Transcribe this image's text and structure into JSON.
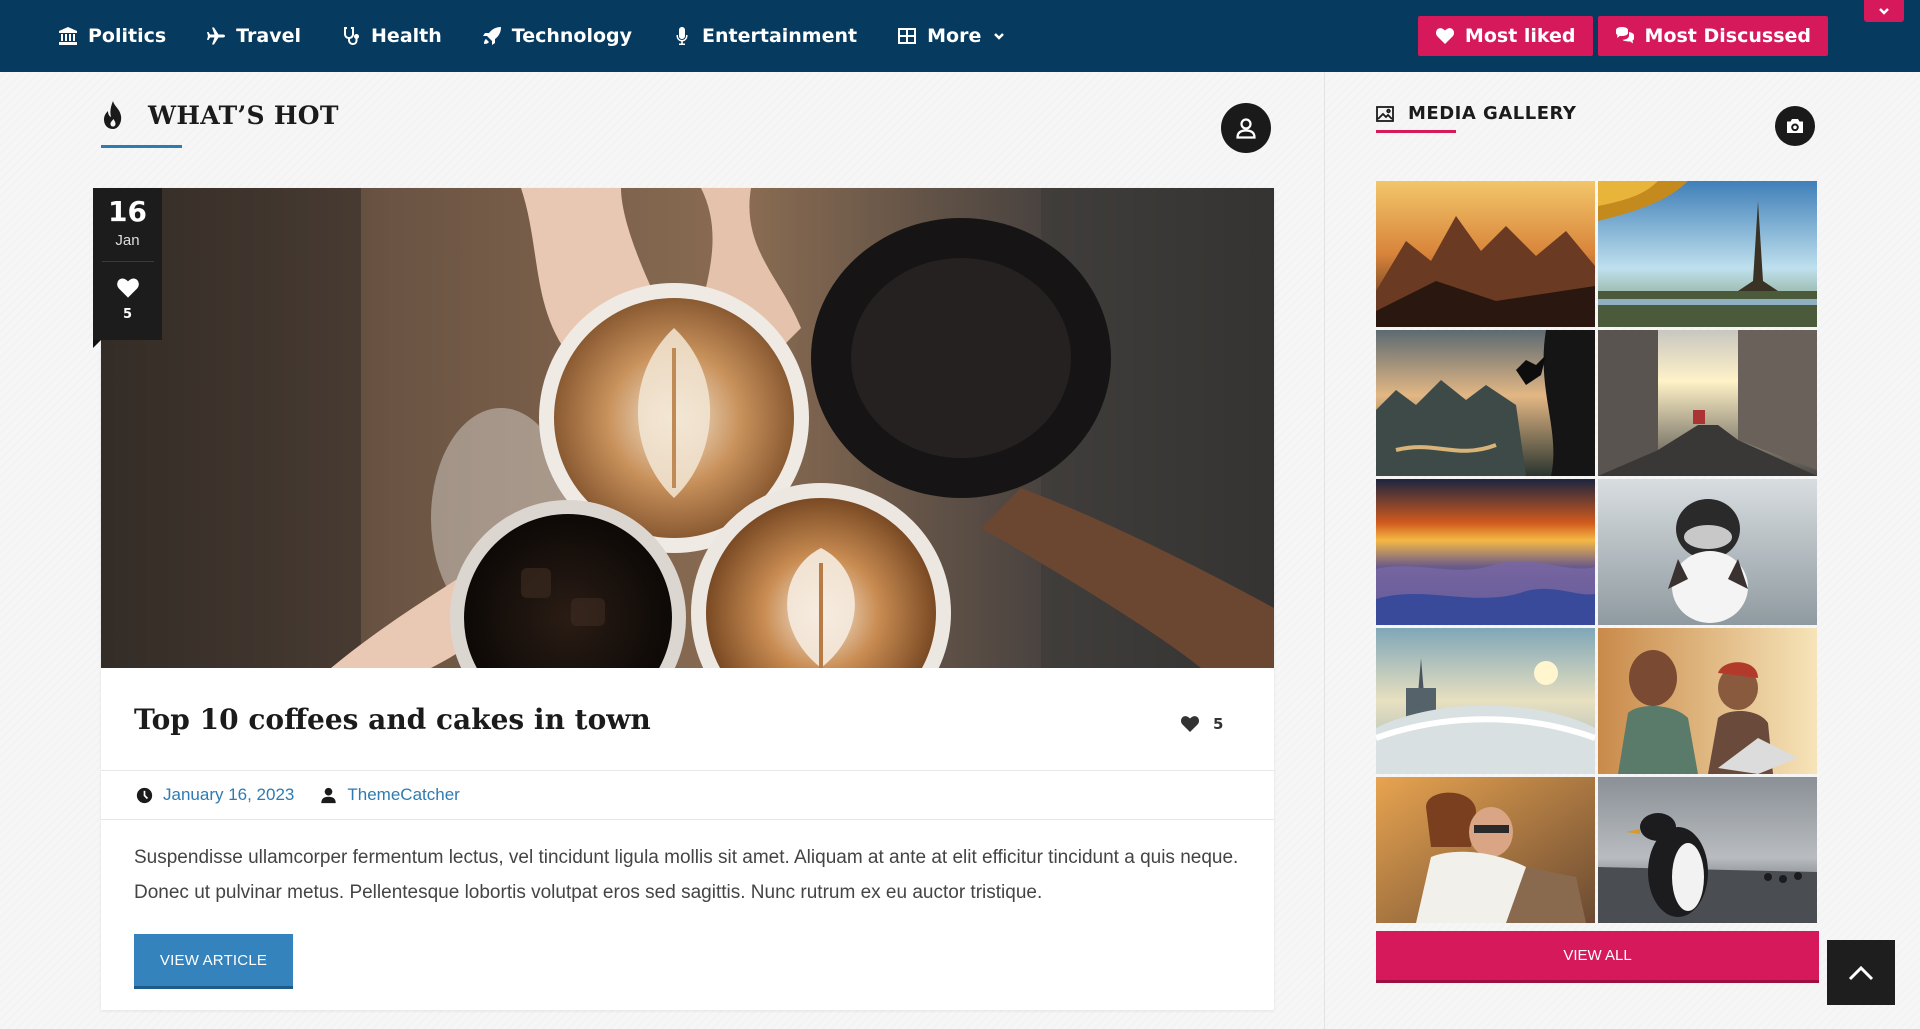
{
  "nav": {
    "items": [
      {
        "label": "Politics",
        "icon": "bank-icon"
      },
      {
        "label": "Travel",
        "icon": "plane-icon"
      },
      {
        "label": "Health",
        "icon": "stethoscope-icon"
      },
      {
        "label": "Technology",
        "icon": "rocket-icon"
      },
      {
        "label": "Entertainment",
        "icon": "microphone-icon"
      },
      {
        "label": "More",
        "icon": "grid-icon"
      }
    ],
    "most_liked": "Most liked",
    "most_discussed": "Most Discussed"
  },
  "section": {
    "title": "WHAT’S HOT"
  },
  "post": {
    "day": "16",
    "month": "Jan",
    "likes": "5",
    "title": "Top 10 coffees and cakes in town",
    "date": "January 16, 2023",
    "author": "ThemeCatcher",
    "excerpt": "Suspendisse ullamcorper fermentum lectus, vel tincidunt ligula mollis sit amet. Aliquam at ante at elit efficitur tincidunt a quis neque. Donec ut pulvinar metus. Pellentesque lobortis volutpat eros sed sagittis. Nunc rutrum ex eu auctor tristique.",
    "button": "VIEW ARTICLE"
  },
  "gallery": {
    "title": "MEDIA GALLERY",
    "view_all": "VIEW ALL",
    "thumbs": [
      "mountains-sunset",
      "eiffel-tower",
      "cliff-climber",
      "city-street",
      "desert-sunset",
      "snow-rider",
      "futuristic-city",
      "man-laptop",
      "couple-hug",
      "penguin"
    ]
  },
  "colors": {
    "nav_bg": "#063a5e",
    "accent_pink": "#d5195b",
    "accent_blue": "#3483bc"
  }
}
